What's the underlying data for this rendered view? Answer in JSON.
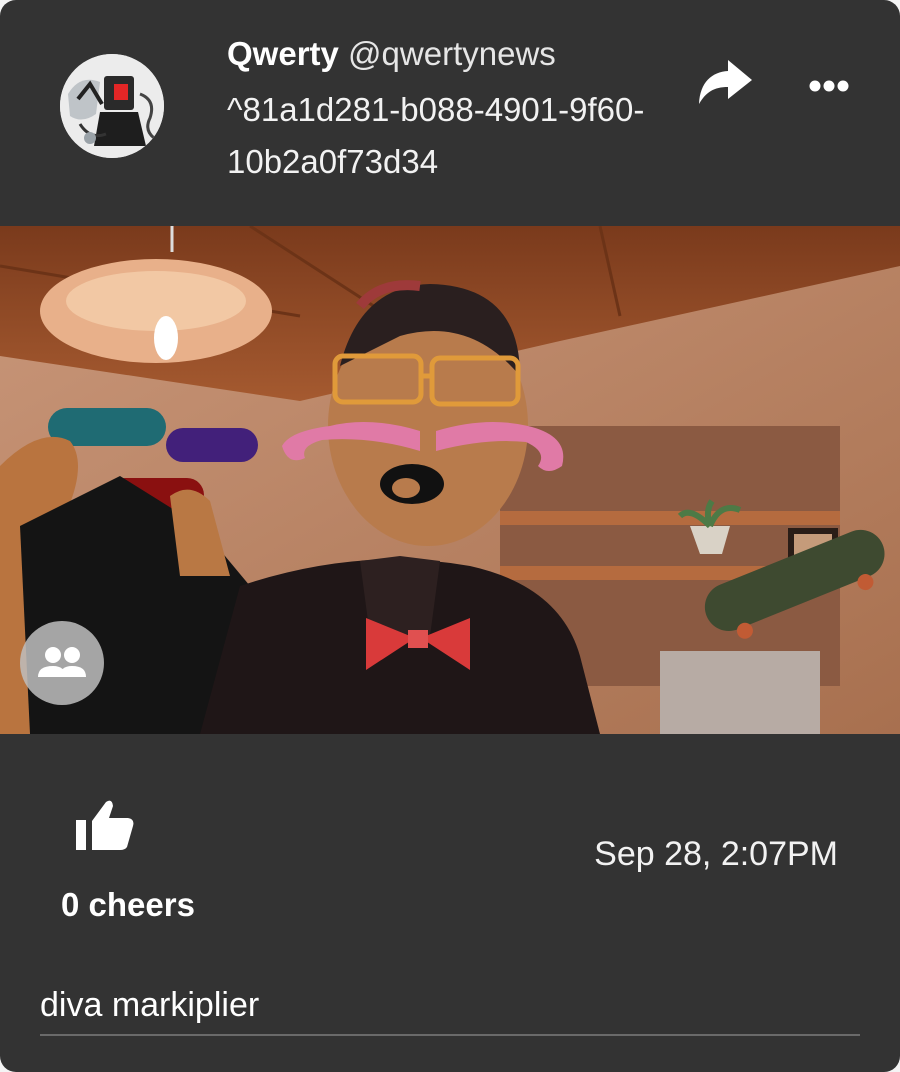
{
  "post": {
    "user_name": "Qwerty",
    "user_handle": "@qwertynews",
    "post_id": "^81a1d281-b088-4901-9f60-10b2a0f73d34",
    "timestamp": "Sep 28, 2:07PM",
    "cheers_label": "0 cheers",
    "cheers_count": 0,
    "caption": "diva markiplier"
  },
  "icons": {
    "share": "share-arrow-icon",
    "more": "more-dots-icon",
    "cheer": "thumbs-up-icon",
    "people": "people-group-icon"
  },
  "colors": {
    "card_background": "#333333",
    "text_primary": "#ffffff",
    "people_button": "#bdbdbd"
  }
}
